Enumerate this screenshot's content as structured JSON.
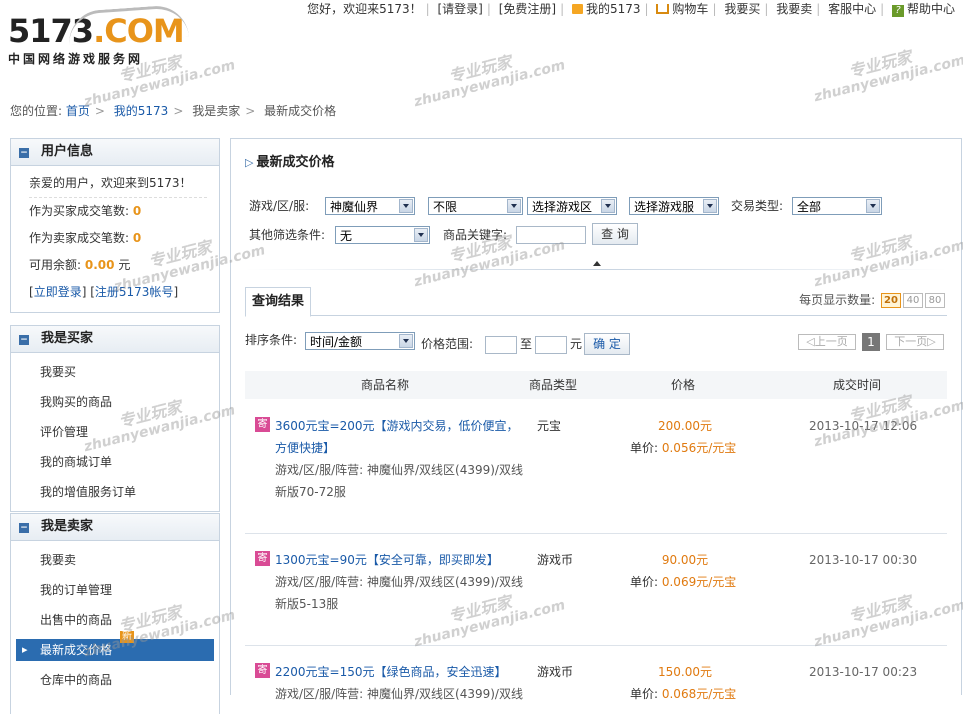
{
  "topbar": {
    "greeting": "您好，欢迎来5173！",
    "login": "[请登录]",
    "register": "[免费注册]",
    "my5173": "我的5173",
    "cart": "购物车",
    "buy": "我要买",
    "sell": "我要卖",
    "service": "客服中心",
    "help": "帮助中心"
  },
  "logo": {
    "main_a": "5173",
    "main_b": ".COM",
    "sub": "中国网络游戏服务网"
  },
  "breadcrumb": {
    "prefix": "您的位置:",
    "items": [
      "首页",
      "我的5173",
      "我是卖家",
      "最新成交价格"
    ]
  },
  "user_panel": {
    "title": "用户信息",
    "hello": "亲爱的用户，欢迎来到5173！",
    "buyer_label": "作为买家成交笔数:",
    "buyer_count": "0",
    "seller_label": "作为卖家成交笔数:",
    "seller_count": "0",
    "balance_label": "可用余额:",
    "balance_value": "0.00",
    "balance_unit": "元",
    "login_link": "立即登录",
    "register_link": "注册5173帐号"
  },
  "buyer_panel": {
    "title": "我是买家",
    "items": [
      "我要买",
      "我购买的商品",
      "评价管理",
      "我的商城订单",
      "我的增值服务订单"
    ]
  },
  "seller_panel": {
    "title": "我是卖家",
    "items": [
      "我要卖",
      "我的订单管理",
      "出售中的商品",
      "最新成交价格",
      "仓库中的商品"
    ],
    "new_badge": "新"
  },
  "main": {
    "title": "最新成交价格",
    "game_label": "游戏/区/服:",
    "game_value": "神魔仙界",
    "sel2_value": "不限",
    "sel3_value": "选择游戏区",
    "sel4_value": "选择游戏服",
    "trade_type_label": "交易类型:",
    "trade_type_value": "全部",
    "other_label": "其他筛选条件:",
    "other_value": "无",
    "keyword_label": "商品关键字:",
    "keyword_value": "",
    "query_button": "查 询"
  },
  "results": {
    "tab": "查询结果",
    "per_page_label": "每页显示数量:",
    "per_page_options": [
      "20",
      "40",
      "80"
    ],
    "sort_label": "排序条件:",
    "sort_value": "时间/金额",
    "price_range_label": "价格范围:",
    "to": "至",
    "unit": "元",
    "confirm_button": "确 定",
    "prev": "上一页",
    "page": "1",
    "next": "下一页",
    "columns": [
      "商品名称",
      "商品类型",
      "价格",
      "成交时间"
    ],
    "rows": [
      {
        "tag": "寄",
        "title": "3600元宝=200元【游戏内交易，低价便宜，方便快捷】",
        "server_line1": "游戏/区/服/阵营: 神魔仙界/双线区(4399)/双线",
        "server_line2": "新版70-72服",
        "type": "元宝",
        "price": "200.00元",
        "unit_label": "单价: ",
        "unit_price": "0.056元/元宝",
        "time": "2013-10-17 12:06"
      },
      {
        "tag": "寄",
        "title": "1300元宝=90元【安全可靠，即买即发】",
        "server_line1": "游戏/区/服/阵营: 神魔仙界/双线区(4399)/双线",
        "server_line2": "新版5-13服",
        "type": "游戏币",
        "price": "90.00元",
        "unit_label": "单价: ",
        "unit_price": "0.069元/元宝",
        "time": "2013-10-17 00:30"
      },
      {
        "tag": "寄",
        "title": "2200元宝=150元【绿色商品，安全迅速】",
        "server_line1": "游戏/区/服/阵营: 神魔仙界/双线区(4399)/双线",
        "server_line2": "",
        "type": "游戏币",
        "price": "150.00元",
        "unit_label": "单价: ",
        "unit_price": "0.068元/元宝",
        "time": "2013-10-17 00:23"
      }
    ]
  },
  "watermark": {
    "cn": "专业玩家",
    "en": "zhuanyewanjia.com"
  },
  "colors": {
    "link": "#1a5aa8",
    "accent_orange": "#e8941a",
    "tag_pink": "#d94b95",
    "active_blue": "#2b6cb0"
  }
}
